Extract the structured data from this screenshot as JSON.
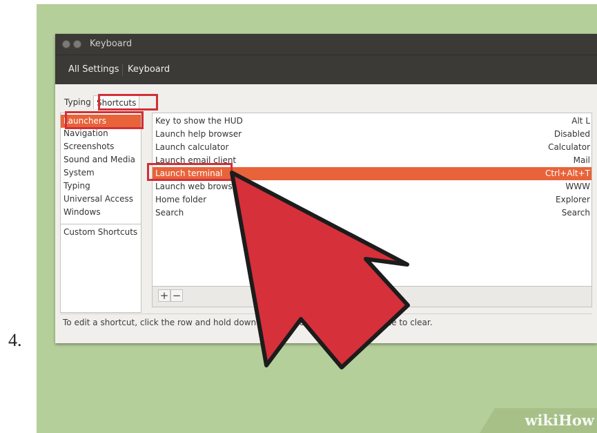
{
  "step": {
    "number": "4."
  },
  "window": {
    "title": "Keyboard",
    "toolbar": {
      "all_settings": "All Settings",
      "keyboard": "Keyboard"
    }
  },
  "tabs": [
    {
      "label": "Typing",
      "active": false
    },
    {
      "label": "Shortcuts",
      "active": true
    }
  ],
  "categories": [
    {
      "label": "Launchers",
      "selected": true
    },
    {
      "label": "Navigation"
    },
    {
      "label": "Screenshots"
    },
    {
      "label": "Sound and Media"
    },
    {
      "label": "System"
    },
    {
      "label": "Typing"
    },
    {
      "label": "Universal Access"
    },
    {
      "label": "Windows"
    },
    {
      "label": "Custom Shortcuts"
    }
  ],
  "shortcuts": [
    {
      "name": "Key to show the HUD",
      "key": "Alt L"
    },
    {
      "name": "Launch help browser",
      "key": "Disabled"
    },
    {
      "name": "Launch calculator",
      "key": "Calculator"
    },
    {
      "name": "Launch email client",
      "key": "Mail"
    },
    {
      "name": "Launch terminal",
      "key": "Ctrl+Alt+T",
      "selected": true
    },
    {
      "name": "Launch web browser",
      "key": "WWW"
    },
    {
      "name": "Home folder",
      "key": "Explorer"
    },
    {
      "name": "Search",
      "key": "Search"
    }
  ],
  "list_toolbar": {
    "add": "+",
    "remove": "−"
  },
  "hint": "To edit a shortcut, click the row and hold down the new keys or press Backspace to clear.",
  "watermark": {
    "part1": "wiki",
    "part2": "How"
  },
  "colors": {
    "selection": "#e8633a",
    "highlight": "#d22f37",
    "background": "#b5cf9a",
    "titlebar": "#3b3a36"
  }
}
